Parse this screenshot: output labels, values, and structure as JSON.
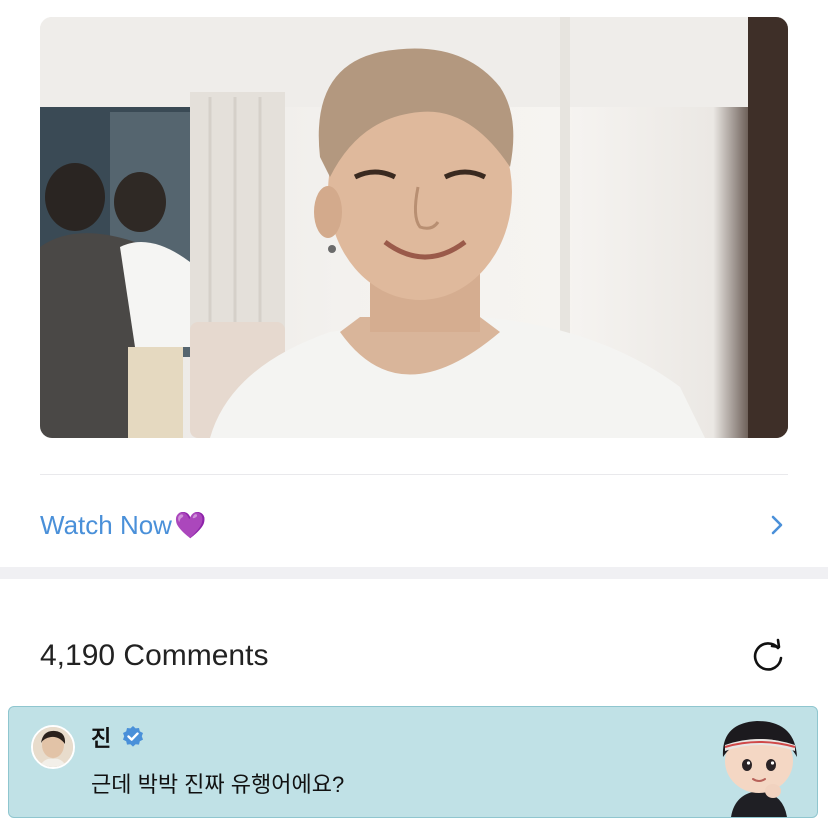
{
  "post": {
    "watch_label": "Watch Now",
    "watch_emoji": "💜",
    "accent_color": "#4a90d9"
  },
  "comments": {
    "count_label": "4,190 Comments"
  },
  "highlighted_comment": {
    "username": "진",
    "text": "근데 박박 진짜 유행어에요?",
    "card_color": "#c0e1e6",
    "verified_color": "#4a90d9"
  },
  "icons": {
    "chevron": "chevron-right-icon",
    "refresh": "refresh-icon",
    "verified": "verified-badge-icon"
  }
}
